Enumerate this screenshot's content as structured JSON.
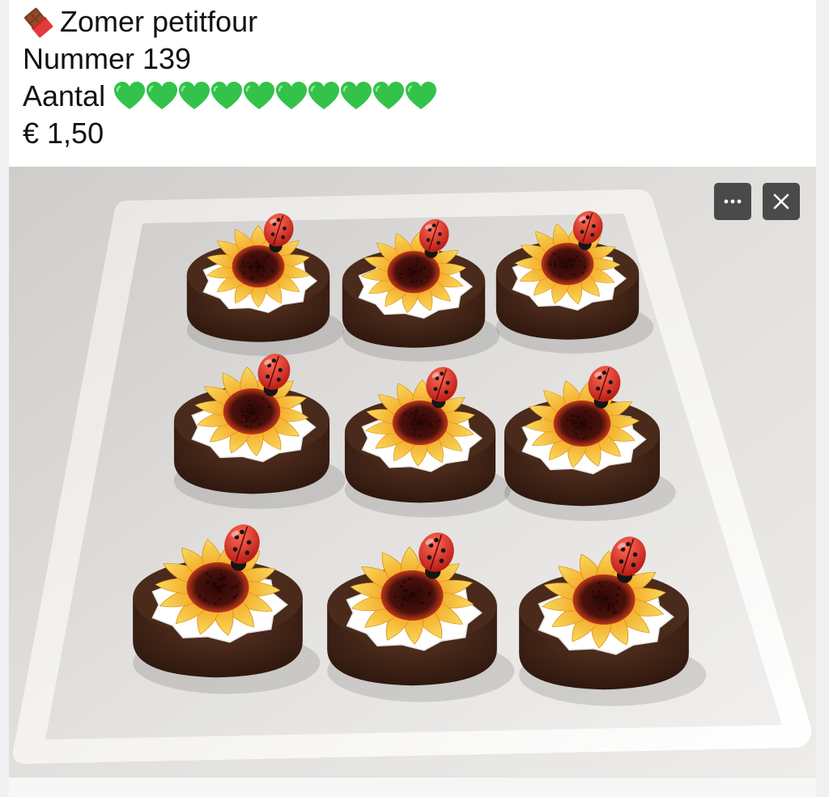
{
  "post": {
    "title": "Zomer petitfour",
    "number_line": "Nummer 139",
    "quantity_label": "Aantal",
    "quantity_hearts": 10,
    "price": "€ 1,50",
    "title_icon": "chocolate-bar-icon",
    "heart_icon": "green-heart-icon",
    "heart_color": "#33c24a"
  },
  "photo": {
    "description_icon_more": "more-options-icon",
    "description_icon_close": "close-icon",
    "petitfours_count": 9,
    "colors": {
      "cake": "#3b2116",
      "petal": "#f4b72a",
      "petal_tip": "#f7d560",
      "center": "#3e0d0a",
      "cream": "#ffffff",
      "ladybug": "#d8221e",
      "plate": "#f3f1ef"
    }
  }
}
